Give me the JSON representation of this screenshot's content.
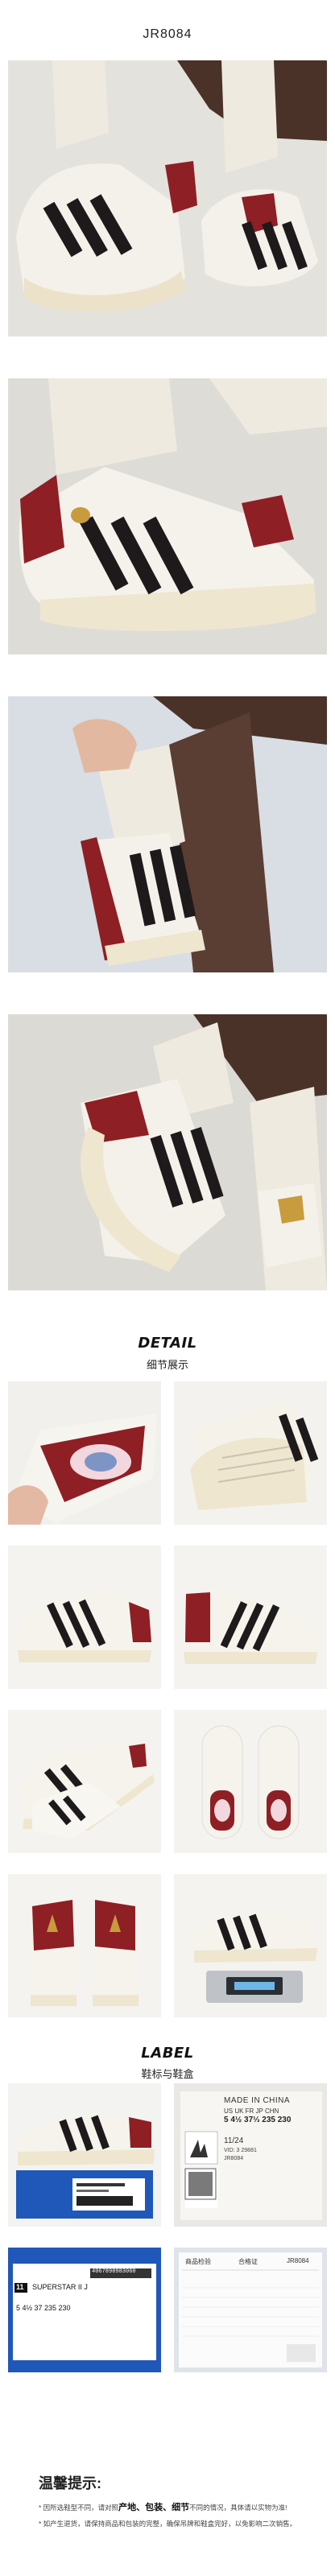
{
  "header": {
    "sku": "JR8084"
  },
  "detail_section": {
    "title": "DETAIL",
    "subtitle": "细节展示"
  },
  "label_section": {
    "title": "LABEL",
    "subtitle": "鞋标与鞋盒"
  },
  "shoe_label": {
    "made_in": "MADE IN CHINA",
    "size_header": "US  UK  FR  JP  CHN",
    "size_values": "5  4½  37⅓  235  230",
    "date": "11/24",
    "code1": "VID: 3 29881",
    "code2": "JR8084"
  },
  "box_label": {
    "size_tag": "11",
    "model": "SUPERSTAR II J",
    "sizes": "5  4½  37  235  230",
    "barcode_text": "4067898983060"
  },
  "certificate": {
    "brand": "商品检验",
    "status": "合格证",
    "sku": "JR8084"
  },
  "reminder": {
    "title": "温馨提示:",
    "line1_prefix": "* 因所选鞋型不同，请对照",
    "line1_bold": "产地、包装、细节",
    "line1_suffix": "不同的情况，具体请以实物为准!",
    "line2": "* 如产生退货，请保持商品和包装的完整，确保吊牌和鞋盒完好，以免影响二次销售。"
  },
  "colors": {
    "burgundy": "#8e1f24",
    "stripe": "#1e1a1c",
    "gold": "#c89b3c",
    "box_blue": "#1f58b8"
  }
}
